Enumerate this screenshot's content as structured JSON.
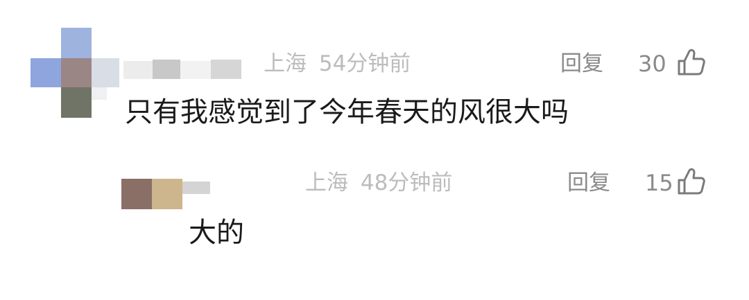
{
  "comments": [
    {
      "location": "上海",
      "time": "54分钟前",
      "reply_label": "回复",
      "likes": "30",
      "text": "只有我感觉到了今年春天的风很大吗"
    },
    {
      "location": "上海",
      "time": "48分钟前",
      "reply_label": "回复",
      "likes": "15",
      "text": "大的"
    }
  ],
  "icons": {
    "like": "thumbs-up-outline-icon"
  },
  "colors": {
    "meta_text": "#bcbcbc",
    "action_text": "#8a8a8a",
    "content_text": "#1a1a1a",
    "background": "#ffffff"
  }
}
